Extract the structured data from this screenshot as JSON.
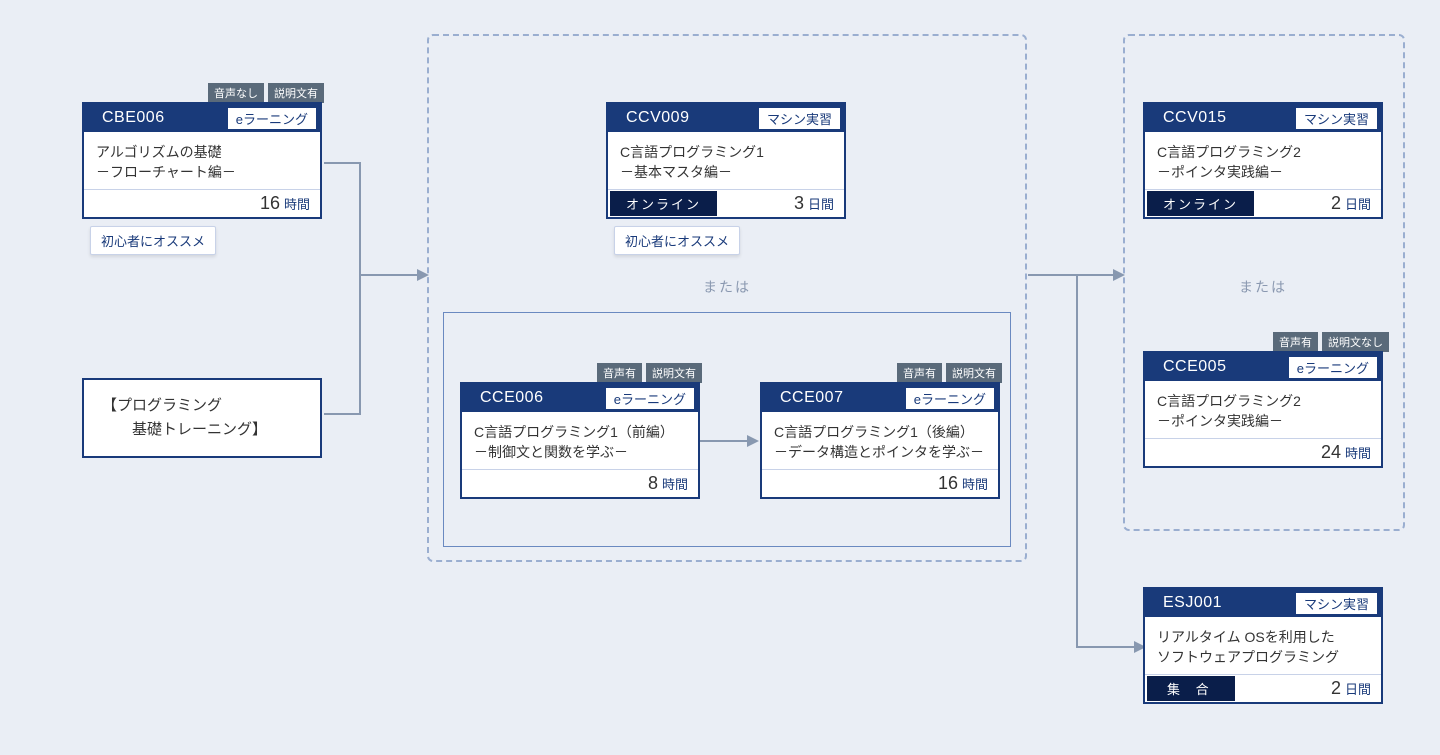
{
  "labels": {
    "or": "または",
    "recommend": "初心者にオススメ",
    "audio_no": "音声なし",
    "audio_yes": "音声有",
    "desc_yes": "説明文有",
    "desc_no": "説明文なし",
    "unit_hours": "時間",
    "unit_days": "日間",
    "type_elearning": "eラーニング",
    "type_machine": "マシン実習",
    "format_online": "オンライン",
    "format_shugo": "集 合"
  },
  "category": {
    "line1": "【プログラミング",
    "line2": "　　基礎トレーニング】"
  },
  "courses": {
    "cbe006": {
      "code": "CBE006",
      "type_key": "type_elearning",
      "title1": "アルゴリズムの基礎",
      "title2": "－フローチャート編－",
      "dur_num": "16",
      "dur_unit_key": "unit_hours"
    },
    "ccv009": {
      "code": "CCV009",
      "type_key": "type_machine",
      "title1": "C言語プログラミング1",
      "title2": "－基本マスタ編－",
      "dur_num": "3",
      "dur_unit_key": "unit_days",
      "format_key": "format_online"
    },
    "cce006": {
      "code": "CCE006",
      "type_key": "type_elearning",
      "title1": "C言語プログラミング1（前編）",
      "title2": "－制御文と関数を学ぶ－",
      "dur_num": "8",
      "dur_unit_key": "unit_hours"
    },
    "cce007": {
      "code": "CCE007",
      "type_key": "type_elearning",
      "title1": "C言語プログラミング1（後編）",
      "title2": "－データ構造とポインタを学ぶ－",
      "dur_num": "16",
      "dur_unit_key": "unit_hours"
    },
    "ccv015": {
      "code": "CCV015",
      "type_key": "type_machine",
      "title1": "C言語プログラミング2",
      "title2": "－ポインタ実践編－",
      "dur_num": "2",
      "dur_unit_key": "unit_days",
      "format_key": "format_online"
    },
    "cce005": {
      "code": "CCE005",
      "type_key": "type_elearning",
      "title1": "C言語プログラミング2",
      "title2": "－ポインタ実践編－",
      "dur_num": "24",
      "dur_unit_key": "unit_hours"
    },
    "esj001": {
      "code": "ESJ001",
      "type_key": "type_machine",
      "title1": "リアルタイム OSを利用した",
      "title2": "ソフトウェアプログラミング",
      "dur_num": "2",
      "dur_unit_key": "unit_days",
      "format_key": "format_shugo"
    }
  }
}
